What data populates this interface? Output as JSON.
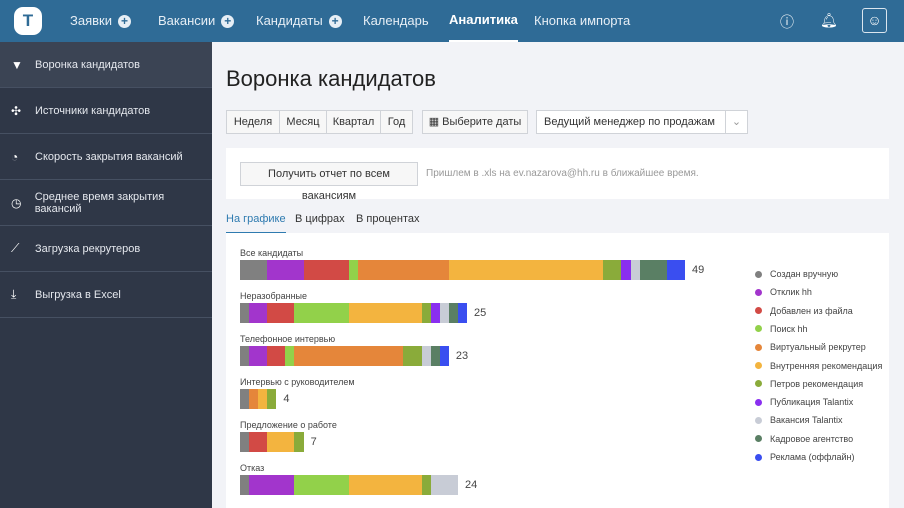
{
  "header": {
    "logo": "T",
    "nav": [
      {
        "label": "Заявки",
        "plus": true
      },
      {
        "label": "Вакансии",
        "plus": true
      },
      {
        "label": "Кандидаты",
        "plus": true
      },
      {
        "label": "Календарь"
      },
      {
        "label": "Аналитика",
        "active": true
      },
      {
        "label": "Кнопка импорта"
      }
    ]
  },
  "sidebar": {
    "items": [
      {
        "label": "Воронка кандидатов",
        "icon": "▼",
        "name": "funnel-icon"
      },
      {
        "label": "Источники кандидатов",
        "icon": "✣",
        "name": "sources-icon"
      },
      {
        "label": "Скорость закрытия вакансий",
        "icon": "◔",
        "name": "speedometer-icon"
      },
      {
        "label": "Среднее время закрытия вакансий",
        "icon": "◷",
        "name": "clock-icon"
      },
      {
        "label": "Загрузка рекрутеров",
        "icon": "⟋",
        "name": "chart-line-icon"
      },
      {
        "label": "Выгрузка в Excel",
        "icon": "⤓",
        "name": "download-icon"
      }
    ]
  },
  "page": {
    "title": "Воронка кандидатов",
    "periods": [
      "Неделя",
      "Месяц",
      "Квартал",
      "Год"
    ],
    "date_button": "Выберите даты",
    "manager_select": "Ведущий менеджер по продажам",
    "report_button": "Получить отчет по всем вакансиям",
    "report_note": "Пришлем в .xls на ev.nazarova@hh.ru в ближайшее время.",
    "tabs": [
      "На графике",
      "В цифрах",
      "В процентах"
    ]
  },
  "chart_data": {
    "type": "bar",
    "stacked": true,
    "orientation": "horizontal",
    "categories": [
      "Все кандидаты",
      "Неразобранные",
      "Телефонное интервью",
      "Интервью с руководителем",
      "Предложение о работе",
      "Отказ"
    ],
    "totals": [
      49,
      25,
      23,
      4,
      7,
      24
    ],
    "series": [
      {
        "name": "Создан вручную",
        "color": "#808080",
        "values": [
          3,
          1,
          1,
          1,
          1,
          1
        ]
      },
      {
        "name": "Отклик hh",
        "color": "#a235cc",
        "values": [
          4,
          2,
          2,
          0,
          0,
          5
        ]
      },
      {
        "name": "Добавлен из файла",
        "color": "#d24a45",
        "values": [
          5,
          3,
          2,
          0,
          2,
          0
        ]
      },
      {
        "name": "Поиск hh",
        "color": "#92d14a",
        "values": [
          1,
          6,
          1,
          0,
          0,
          6
        ]
      },
      {
        "name": "Виртуальный рекрутер",
        "color": "#e5863a",
        "values": [
          10,
          0,
          12,
          1,
          0,
          0
        ]
      },
      {
        "name": "Внутренняя рекомендация",
        "color": "#f3b43f",
        "values": [
          17,
          8,
          0,
          1,
          3,
          8
        ]
      },
      {
        "name": "Петров рекомендация",
        "color": "#8aab3a",
        "values": [
          2,
          1,
          2,
          1,
          1,
          1
        ]
      },
      {
        "name": "Публикация Talantix",
        "color": "#8a2ff0",
        "values": [
          1,
          1,
          0,
          0,
          0,
          0
        ]
      },
      {
        "name": "Вакансия Talantix",
        "color": "#c8ccd6",
        "values": [
          1,
          1,
          1,
          0,
          0,
          3
        ]
      },
      {
        "name": "Кадровое агентство",
        "color": "#5a7f64",
        "values": [
          3,
          1,
          1,
          0,
          0,
          0
        ]
      },
      {
        "name": "Реклама (оффлайн)",
        "color": "#3a4ef0",
        "values": [
          2,
          1,
          1,
          0,
          0,
          0
        ]
      }
    ],
    "legend": "right"
  }
}
